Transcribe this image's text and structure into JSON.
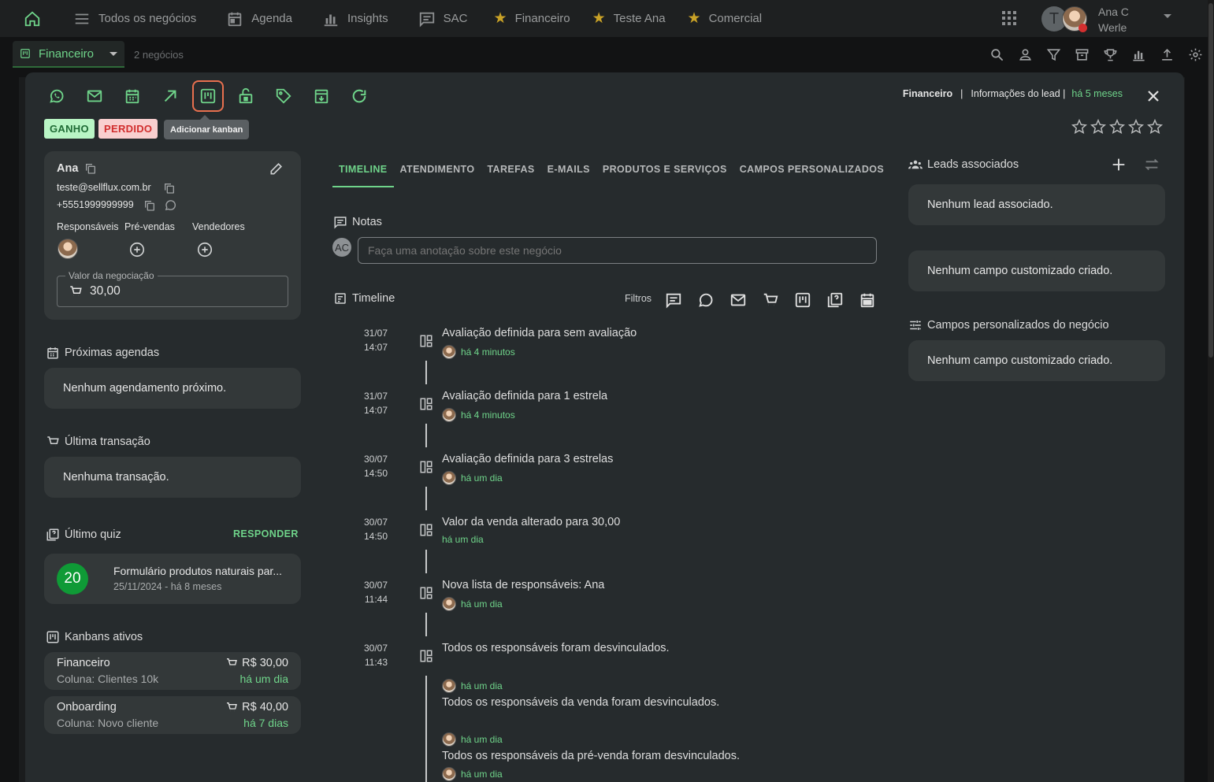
{
  "topnav": {
    "items": [
      {
        "label": "Todos os negócios",
        "icon": "list-icon"
      },
      {
        "label": "Agenda",
        "icon": "calendar-icon"
      },
      {
        "label": "Insights",
        "icon": "bar-chart-icon"
      },
      {
        "label": "SAC",
        "icon": "chat-icon"
      },
      {
        "label": "Financeiro",
        "icon": "star-icon"
      },
      {
        "label": "Teste Ana",
        "icon": "star-icon"
      },
      {
        "label": "Comercial",
        "icon": "star-icon"
      }
    ],
    "user_initial": "T",
    "user_name_line1": "Ana C",
    "user_name_line2": "Werle"
  },
  "subbar": {
    "board": "Financeiro",
    "count": "2 negócios"
  },
  "modal": {
    "toolbar_icons": [
      "whatsapp-icon",
      "mail-icon",
      "calendar-icon",
      "arrow-up-right-icon",
      "kanban-icon",
      "lock-icon",
      "tag-icon",
      "archive-icon",
      "refresh-icon"
    ],
    "tag_won": "GANHO",
    "tag_lost": "PERDIDO",
    "tooltip": "Adicionar kanban",
    "header": {
      "board": "Financeiro",
      "sep": "|",
      "info": "Informações do lead |",
      "time": "há 5 meses"
    },
    "rating": 0
  },
  "lead": {
    "name": "Ana",
    "email": "teste@sellflux.com.br",
    "phone": "+5551999999999",
    "roles": [
      "Responsáveis",
      "Pré-vendas",
      "Vendedores"
    ],
    "value_label": "Valor da negociação",
    "value": "30,00"
  },
  "agenda": {
    "title": "Próximas agendas",
    "empty": "Nenhum agendamento próximo."
  },
  "transaction": {
    "title": "Última transação",
    "empty": "Nenhuma transação."
  },
  "quiz": {
    "title": "Último quiz",
    "action": "RESPONDER",
    "score": "20",
    "name": "Formulário produtos naturais par...",
    "date": "25/11/2024 - há 8 meses"
  },
  "kanbans": {
    "title": "Kanbans ativos",
    "items": [
      {
        "name": "Financeiro",
        "column": "Coluna: Clientes 10k",
        "value": "R$ 30,00",
        "time": "há um dia"
      },
      {
        "name": "Onboarding",
        "column": "Coluna: Novo cliente",
        "value": "R$ 40,00",
        "time": "há 7 dias"
      }
    ]
  },
  "tabs": [
    "TIMELINE",
    "ATENDIMENTO",
    "TAREFAS",
    "E-MAILS",
    "PRODUTOS E SERVIÇOS",
    "CAMPOS PERSONALIZADOS"
  ],
  "notes": {
    "title": "Notas",
    "avatar": "AC",
    "placeholder": "Faça uma anotação sobre este negócio"
  },
  "timeline": {
    "title": "Timeline",
    "filters_label": "Filtros",
    "entries": [
      {
        "date": "31/07",
        "time": "14:07",
        "text": "Avaliação definida para sem avaliação",
        "meta": "há 4 minutos"
      },
      {
        "date": "31/07",
        "time": "14:07",
        "text": "Avaliação definida para 1 estrela",
        "meta": "há 4 minutos"
      },
      {
        "date": "30/07",
        "time": "14:50",
        "text": "Avaliação definida para 3 estrelas",
        "meta": "há um dia"
      },
      {
        "date": "30/07",
        "time": "14:50",
        "text": "Valor da venda alterado para 30,00",
        "meta": "há um dia"
      },
      {
        "date": "30/07",
        "time": "11:44",
        "text": "Nova lista de responsáveis: Ana",
        "meta": "há um dia"
      },
      {
        "date": "30/07",
        "time": "11:43",
        "text": "Todos os responsáveis foram desvinculados.",
        "meta": "há um dia"
      }
    ],
    "sub_entries": [
      {
        "text": "Todos os responsáveis da venda foram desvinculados.",
        "meta": "há um dia"
      },
      {
        "text": "Todos os responsáveis da pré-venda foram desvinculados.",
        "meta": "há um dia"
      }
    ]
  },
  "right": {
    "leads_title": "Leads associados",
    "leads_empty": "Nenhum lead associado.",
    "custom_empty": "Nenhum campo customizado criado.",
    "deal_fields_title": "Campos personalizados do negócio",
    "deal_fields_empty": "Nenhum campo customizado criado."
  }
}
